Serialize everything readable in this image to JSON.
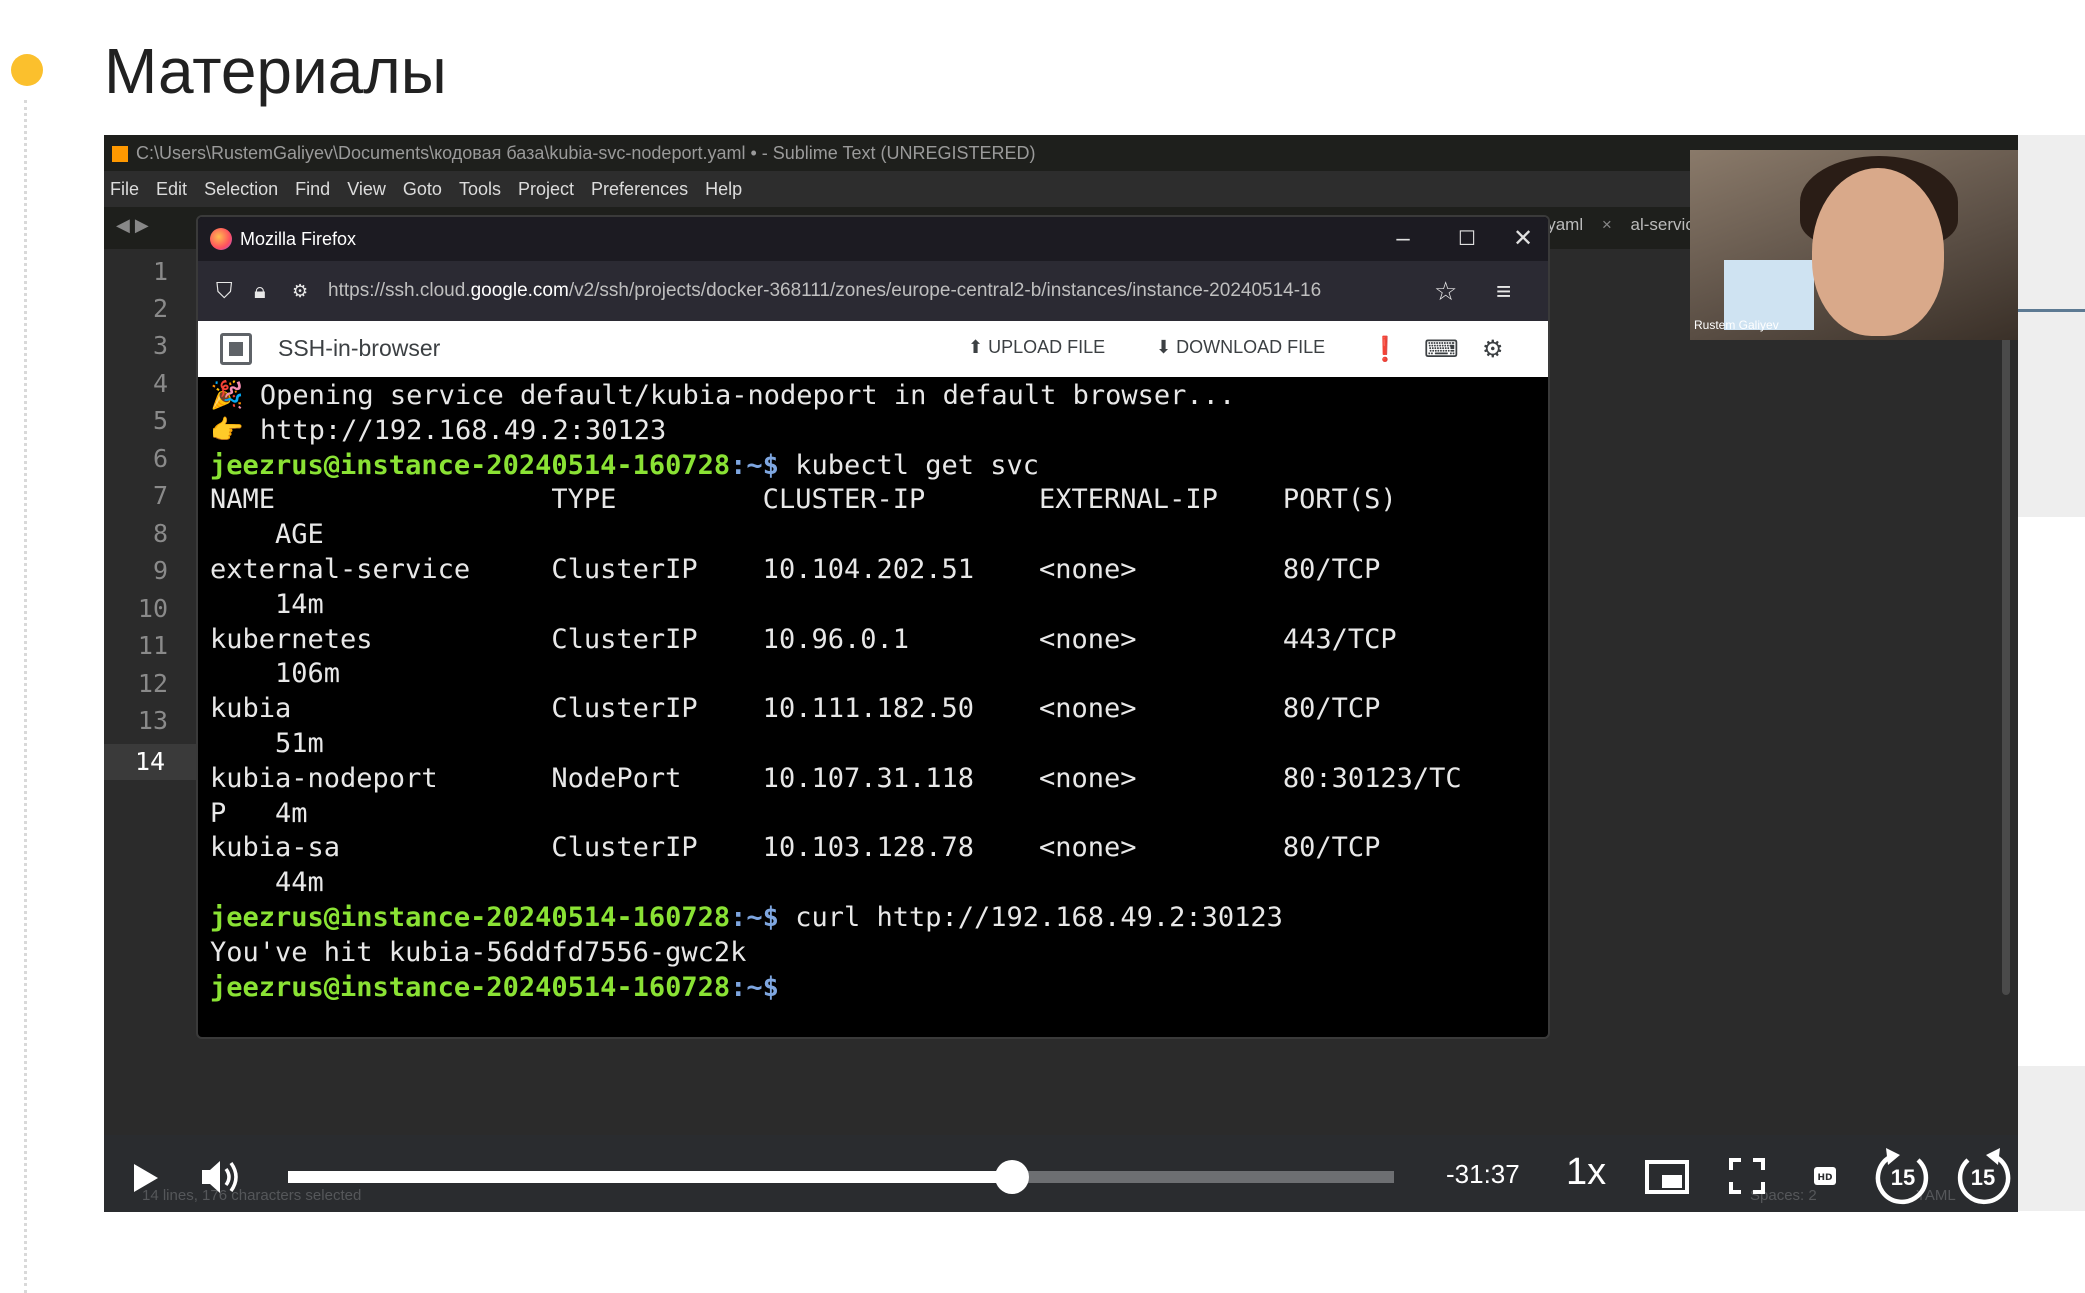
{
  "slide": {
    "title": "Материалы"
  },
  "sublime": {
    "window_title": "C:\\Users\\RustemGaliyev\\Documents\\кодовая база\\kubia-svc-nodeport.yaml • - Sublime Text (UNREGISTERED)",
    "menu": [
      "File",
      "Edit",
      "Selection",
      "Find",
      "View",
      "Goto",
      "Tools",
      "Project",
      "Preferences",
      "Help"
    ],
    "tab_right": "s.yaml",
    "tab_right_close": "×",
    "tab_right2": "al-servic",
    "line_numbers": [
      "1",
      "2",
      "3",
      "4",
      "5",
      "6",
      "7",
      "8",
      "9",
      "10",
      "11",
      "12",
      "13",
      "14"
    ],
    "current_line": "14",
    "status_left": "14 lines, 176 characters selected",
    "status_spaces": "Spaces: 2",
    "status_syntax": "YAML"
  },
  "firefox": {
    "title": "Mozilla Firefox",
    "minimize": "–",
    "maximize": "☐",
    "close": "✕",
    "url_prefix": "https://ssh.cloud.",
    "url_domain": "google.com",
    "url_rest": "/v2/ssh/projects/docker-368111/zones/europe-central2-b/instances/instance-20240514-16"
  },
  "ssh": {
    "app_name": "SSH-in-browser",
    "upload_label": "UPLOAD FILE",
    "download_label": "DOWNLOAD FILE"
  },
  "terminal": {
    "line1": "🎉 Opening service default/kubia-nodeport in default browser...",
    "line2": "👉 http://192.168.49.2:30123",
    "prompt_user": "jeezrus@instance-20240514-160728",
    "prompt_sep": ":~$",
    "cmd1": " kubectl get svc",
    "header1": "NAME                 TYPE         CLUSTER-IP       EXTERNAL-IP    PORT(S)",
    "header2": "    AGE",
    "rows": [
      {
        "a": "external-service     ClusterIP    10.104.202.51    <none>         80/TCP",
        "b": "    14m"
      },
      {
        "a": "kubernetes           ClusterIP    10.96.0.1        <none>         443/TCP",
        "b": "    106m"
      },
      {
        "a": "kubia                ClusterIP    10.111.182.50    <none>         80/TCP",
        "b": "    51m"
      },
      {
        "a": "kubia-nodeport       NodePort     10.107.31.118    <none>         80:30123/TC",
        "b": "P   4m"
      },
      {
        "a": "kubia-sa             ClusterIP    10.103.128.78    <none>         80/TCP",
        "b": "    44m"
      }
    ],
    "cmd2": " curl http://192.168.49.2:30123",
    "output2": "You've hit kubia-56ddfd7556-gwc2k"
  },
  "webcam": {
    "name": "Rustem Galiyev"
  },
  "player": {
    "progress": 0.655,
    "time_remaining": "-31:37",
    "speed": "1x",
    "skip_back": "15",
    "skip_forward": "15"
  },
  "colors": {
    "accent_dot": "#fbc02d",
    "prompt_green": "#8ae234",
    "prompt_blue": "#7ea6e0"
  }
}
